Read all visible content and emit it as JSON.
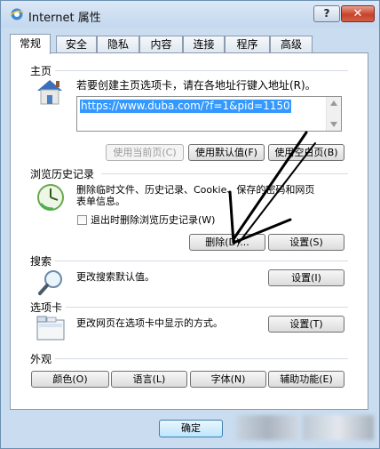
{
  "window": {
    "title": "Internet 属性",
    "help_label": "?",
    "close_label": "✕"
  },
  "tabs": [
    {
      "label": "常规",
      "active": true
    },
    {
      "label": "安全"
    },
    {
      "label": "隐私"
    },
    {
      "label": "内容"
    },
    {
      "label": "连接"
    },
    {
      "label": "程序"
    },
    {
      "label": "高级"
    }
  ],
  "home": {
    "section_label": "主页",
    "description": "若要创建主页选项卡，请在各地址行键入地址(R)。",
    "url": "https://www.duba.com/?f=1&pid=1150",
    "btn_use_current": "使用当前页(C)",
    "btn_use_default": "使用默认值(F)",
    "btn_use_blank": "使用空白页(B)"
  },
  "history": {
    "section_label": "浏览历史记录",
    "description_line1": "删除临时文件、历史记录、Cookie、保存的密码和网页",
    "description_line2": "表单信息。",
    "checkbox_label": "退出时删除浏览历史记录(W)",
    "btn_delete": "删除(D)...",
    "btn_settings": "设置(S)"
  },
  "search": {
    "section_label": "搜索",
    "description": "更改搜索默认值。",
    "btn_settings": "设置(I)"
  },
  "tabs_section": {
    "section_label": "选项卡",
    "description": "更改网页在选项卡中显示的方式。",
    "btn_settings": "设置(T)"
  },
  "appearance": {
    "section_label": "外观",
    "btn_colors": "颜色(O)",
    "btn_languages": "语言(L)",
    "btn_fonts": "字体(N)",
    "btn_accessibility": "辅助功能(E)"
  },
  "footer": {
    "ok_label": "确定"
  },
  "colors": {
    "selection": "#3399ff",
    "panel_border": "#8b9bb0",
    "window_frame": "#c9dcf0"
  }
}
